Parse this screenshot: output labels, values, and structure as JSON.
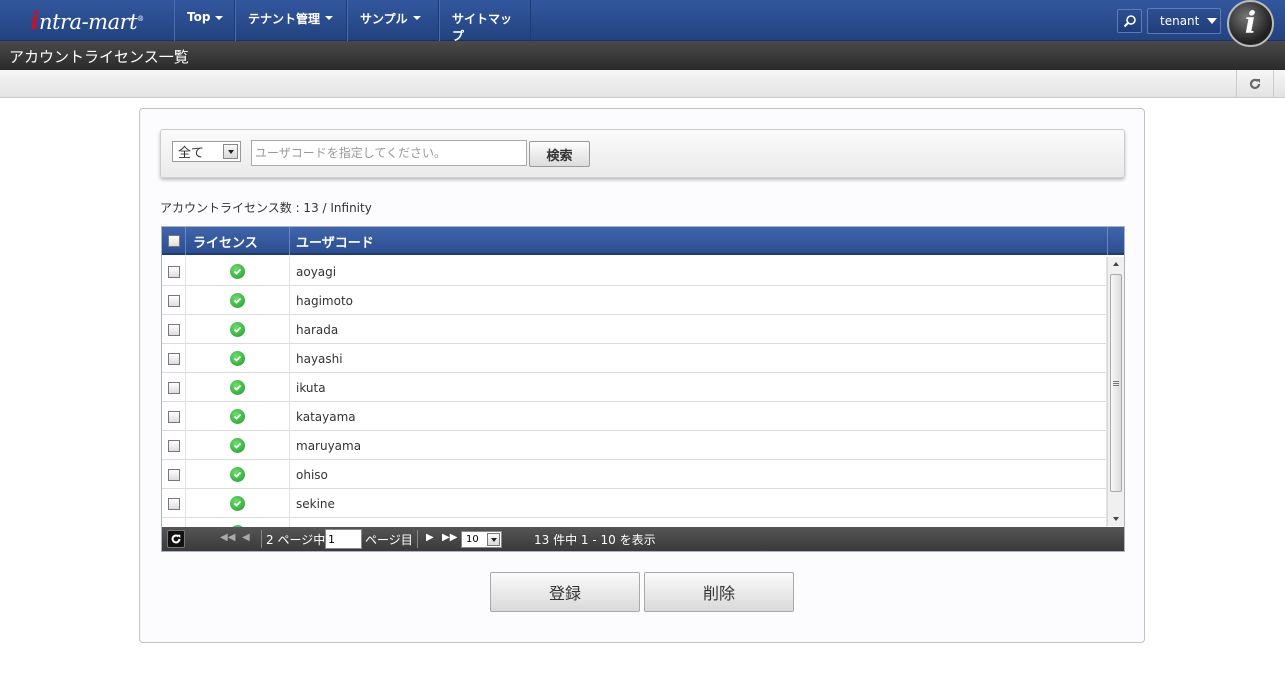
{
  "header": {
    "logo_text": "ntra-mart",
    "logo_initial": "i",
    "logo_reg": "®",
    "nav": [
      {
        "label": "Top"
      },
      {
        "label": "テナント管理"
      },
      {
        "label": "サンプル"
      },
      {
        "label": "サイトマップ"
      }
    ],
    "tenant_label": "tenant"
  },
  "title_bar": {
    "title": "アカウントライセンス一覧"
  },
  "search": {
    "filter_value": "全て",
    "user_placeholder": "ユーザコードを指定してください。",
    "search_label": "検索"
  },
  "summary": {
    "license_count": "アカウントライセンス数 : 13 / Infinity"
  },
  "grid": {
    "columns": [
      "ライセンス",
      "ユーザコード"
    ],
    "rows": [
      {
        "user_code": "aoyagi",
        "licensed": true
      },
      {
        "user_code": "hagimoto",
        "licensed": true
      },
      {
        "user_code": "harada",
        "licensed": true
      },
      {
        "user_code": "hayashi",
        "licensed": true
      },
      {
        "user_code": "ikuta",
        "licensed": true
      },
      {
        "user_code": "katayama",
        "licensed": true
      },
      {
        "user_code": "maruyama",
        "licensed": true
      },
      {
        "user_code": "ohiso",
        "licensed": true
      },
      {
        "user_code": "sekine",
        "licensed": true
      },
      {
        "user_code": "",
        "licensed": true
      }
    ]
  },
  "pager": {
    "first_icon": "◀◀",
    "prev_icon": "◀",
    "next_icon": "▶",
    "last_icon": "▶▶",
    "total_pages_text": "2 ページ中",
    "current_page": "1",
    "page_suffix": "ページ目",
    "rows_per_page": "10",
    "range_text": "13 件中 1 - 10 を表示"
  },
  "actions": {
    "register_label": "登録",
    "delete_label": "削除"
  },
  "colors": {
    "header_blue": "#2c4e91",
    "grid_header_blue": "#3a5ea3",
    "title_bar": "#333333",
    "license_ok_green": "#2aa835"
  }
}
